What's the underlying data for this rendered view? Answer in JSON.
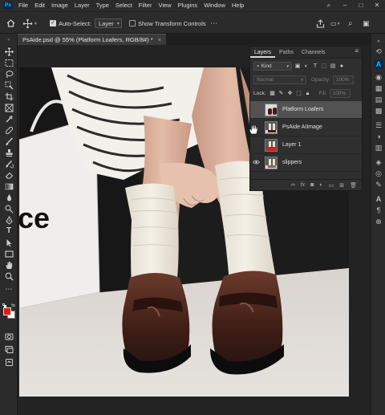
{
  "app": {
    "logo": "Ps"
  },
  "menu": [
    "File",
    "Edit",
    "Image",
    "Layer",
    "Type",
    "Select",
    "Filter",
    "View",
    "Plugins",
    "Window",
    "Help"
  ],
  "options": {
    "auto_select_label": "Auto-Select:",
    "auto_select_checked": true,
    "auto_select_target": "Layer",
    "show_transform_label": "Show Transform Controls",
    "show_transform_checked": false
  },
  "document": {
    "tab_title": "PsAide.psd @ 55% (Platform Loafers, RGB/8#) *",
    "close": "×"
  },
  "layers_panel": {
    "tabs": [
      "Layers",
      "Paths",
      "Channels"
    ],
    "filter_kind": "Kind",
    "blend_mode": "Normal",
    "opacity_label": "Opacity:",
    "opacity_value": "100%",
    "lock_label": "Lock:",
    "fill_label": "Fill:",
    "fill_value": "100%",
    "layers": [
      {
        "name": "Platform Loafers",
        "visible": false,
        "selected": true
      },
      {
        "name": "PsAide AIImage",
        "visible": false,
        "selected": false
      },
      {
        "name": "Layer 1",
        "visible": false,
        "selected": false
      },
      {
        "name": "slippers",
        "visible": true,
        "selected": false
      }
    ]
  },
  "canvas": {
    "bag_text": "ce"
  },
  "colors": {
    "foreground": "#e8190e",
    "background": "#ffffff",
    "accent": "#31a8ff"
  }
}
